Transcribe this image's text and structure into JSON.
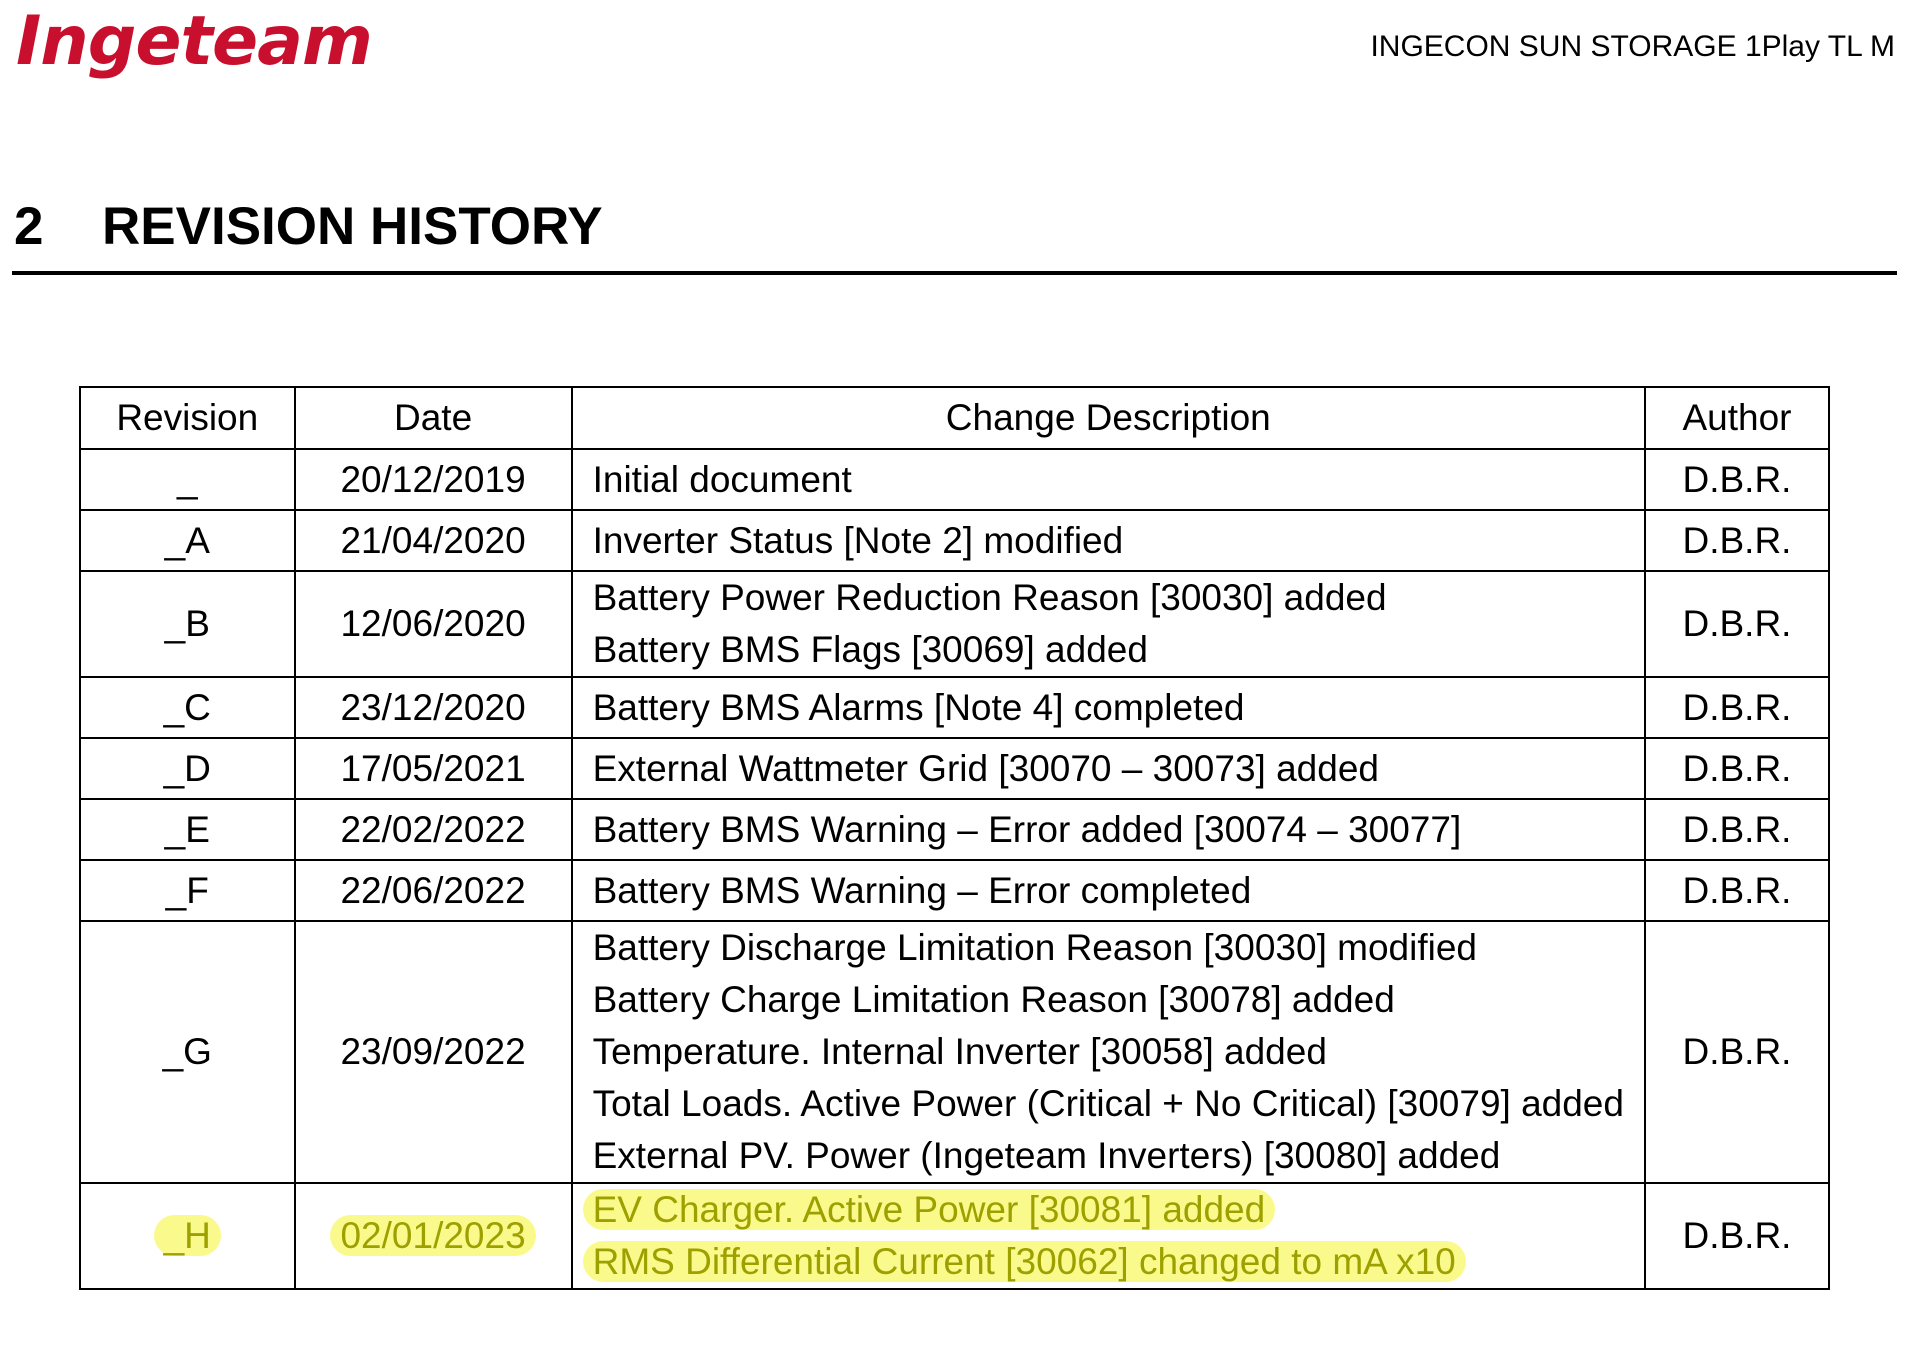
{
  "header": {
    "logo": "Ingeteam",
    "product": "INGECON SUN STORAGE 1Play TL M"
  },
  "section": {
    "number": "2",
    "title": "REVISION HISTORY"
  },
  "table": {
    "columns": [
      "Revision",
      "Date",
      "Change Description",
      "Author"
    ],
    "rows": [
      {
        "revision": "_",
        "date": "20/12/2019",
        "changes": [
          "Initial document"
        ],
        "author": "D.B.R."
      },
      {
        "revision": "_A",
        "date": "21/04/2020",
        "changes": [
          "Inverter Status [Note 2] modified"
        ],
        "author": "D.B.R."
      },
      {
        "revision": "_B",
        "date": "12/06/2020",
        "changes": [
          "Battery Power Reduction Reason [30030] added",
          "Battery BMS Flags [30069] added"
        ],
        "author": "D.B.R."
      },
      {
        "revision": "_C",
        "date": "23/12/2020",
        "changes": [
          "Battery BMS Alarms [Note 4] completed"
        ],
        "author": "D.B.R."
      },
      {
        "revision": "_D",
        "date": "17/05/2021",
        "changes": [
          "External Wattmeter Grid [30070 – 30073] added"
        ],
        "author": "D.B.R."
      },
      {
        "revision": "_E",
        "date": "22/02/2022",
        "changes": [
          "Battery BMS Warning – Error added [30074 – 30077]"
        ],
        "author": "D.B.R."
      },
      {
        "revision": "_F",
        "date": "22/06/2022",
        "changes": [
          "Battery BMS Warning – Error completed"
        ],
        "author": "D.B.R."
      },
      {
        "revision": "_G",
        "date": "23/09/2022",
        "changes": [
          "Battery Discharge Limitation Reason [30030] modified",
          "Battery Charge Limitation Reason [30078] added",
          "Temperature. Internal Inverter [30058] added",
          "Total Loads. Active Power (Critical + No Critical) [30079] added",
          "External PV. Power (Ingeteam Inverters) [30080] added"
        ],
        "author": "D.B.R."
      },
      {
        "revision": "_H",
        "date": "02/01/2023",
        "changes": [
          "EV Charger. Active Power [30081] added",
          "RMS Differential Current [30062] changed to mA x10"
        ],
        "author": "D.B.R."
      }
    ]
  }
}
